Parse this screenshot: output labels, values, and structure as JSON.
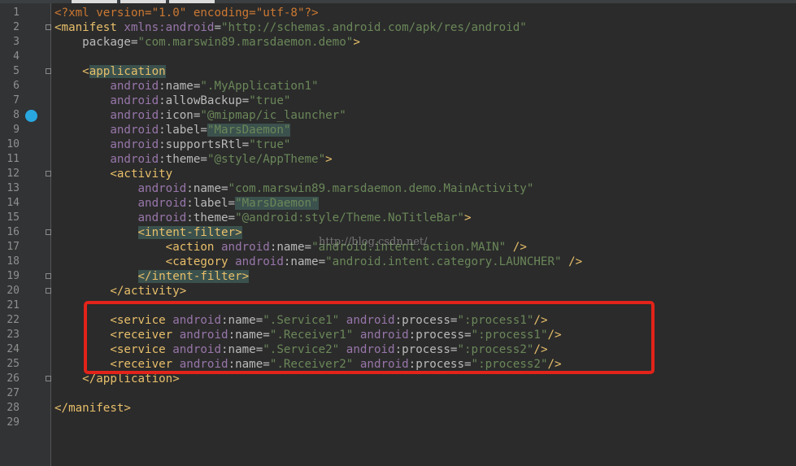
{
  "editor": {
    "watermark": "http://blog.csdn.net/",
    "highlight_color": "#e2231a",
    "breakpoint_color": "#29a8e0",
    "lines": [
      {
        "n": "1",
        "guide": "",
        "segs": [
          {
            "c": "ctl",
            "t": "<?xml version=\"1.0\" encoding=\"utf-8\"?>"
          }
        ]
      },
      {
        "n": "2",
        "guide": "",
        "segs": [
          {
            "c": "tag",
            "t": "<manifest "
          },
          {
            "c": "ns",
            "t": "xmlns:android"
          },
          {
            "c": "attr",
            "t": "="
          },
          {
            "c": "str",
            "t": "\"http://schemas.android.com/apk/res/android\""
          }
        ]
      },
      {
        "n": "3",
        "guide": "    ",
        "segs": [
          {
            "c": "attr",
            "t": "package"
          },
          {
            "c": "attr",
            "t": "="
          },
          {
            "c": "str",
            "t": "\"com.marswin89.marsdaemon.demo\""
          },
          {
            "c": "tag",
            "t": ">"
          }
        ]
      },
      {
        "n": "4",
        "guide": "",
        "segs": []
      },
      {
        "n": "5",
        "guide": "    ",
        "segs": [
          {
            "c": "tag",
            "t": "<"
          },
          {
            "c": "tag hl",
            "t": "application"
          }
        ]
      },
      {
        "n": "6",
        "guide": "        ",
        "segs": [
          {
            "c": "ns",
            "t": "android"
          },
          {
            "c": "attr",
            "t": ":name="
          },
          {
            "c": "str",
            "t": "\".MyApplication1\""
          }
        ]
      },
      {
        "n": "7",
        "guide": "        ",
        "segs": [
          {
            "c": "ns",
            "t": "android"
          },
          {
            "c": "attr",
            "t": ":allowBackup="
          },
          {
            "c": "str",
            "t": "\"true\""
          }
        ]
      },
      {
        "n": "8",
        "guide": "        ",
        "segs": [
          {
            "c": "ns",
            "t": "android"
          },
          {
            "c": "attr",
            "t": ":icon="
          },
          {
            "c": "str",
            "t": "\"@mipmap/ic_launcher\""
          }
        ]
      },
      {
        "n": "9",
        "guide": "        ",
        "segs": [
          {
            "c": "ns",
            "t": "android"
          },
          {
            "c": "attr",
            "t": ":label="
          },
          {
            "c": "str hl",
            "t": "\"MarsDaemon\""
          }
        ]
      },
      {
        "n": "10",
        "guide": "        ",
        "segs": [
          {
            "c": "ns",
            "t": "android"
          },
          {
            "c": "attr",
            "t": ":supportsRtl="
          },
          {
            "c": "str",
            "t": "\"true\""
          }
        ]
      },
      {
        "n": "11",
        "guide": "        ",
        "segs": [
          {
            "c": "ns",
            "t": "android"
          },
          {
            "c": "attr",
            "t": ":theme="
          },
          {
            "c": "str",
            "t": "\"@style/AppTheme\""
          },
          {
            "c": "tag",
            "t": ">"
          }
        ]
      },
      {
        "n": "12",
        "guide": "        ",
        "segs": [
          {
            "c": "tag",
            "t": "<activity"
          }
        ]
      },
      {
        "n": "13",
        "guide": "            ",
        "segs": [
          {
            "c": "ns",
            "t": "android"
          },
          {
            "c": "attr",
            "t": ":name="
          },
          {
            "c": "str",
            "t": "\"com.marswin89.marsdaemon.demo.MainActivity\""
          }
        ]
      },
      {
        "n": "14",
        "guide": "            ",
        "segs": [
          {
            "c": "ns",
            "t": "android"
          },
          {
            "c": "attr",
            "t": ":label="
          },
          {
            "c": "str hl",
            "t": "\"MarsDaemon\""
          }
        ]
      },
      {
        "n": "15",
        "guide": "            ",
        "segs": [
          {
            "c": "ns",
            "t": "android"
          },
          {
            "c": "attr",
            "t": ":theme="
          },
          {
            "c": "str",
            "t": "\"@android:style/Theme.NoTitleBar\""
          },
          {
            "c": "tag",
            "t": ">"
          }
        ]
      },
      {
        "n": "16",
        "guide": "            ",
        "segs": [
          {
            "c": "tag hl",
            "t": "<intent-filter>"
          }
        ]
      },
      {
        "n": "17",
        "guide": "                ",
        "segs": [
          {
            "c": "tag",
            "t": "<action "
          },
          {
            "c": "ns",
            "t": "android"
          },
          {
            "c": "attr",
            "t": ":name="
          },
          {
            "c": "str",
            "t": "\"android.intent.action.MAIN\""
          },
          {
            "c": "tag",
            "t": " />"
          }
        ]
      },
      {
        "n": "18",
        "guide": "                ",
        "segs": [
          {
            "c": "tag",
            "t": "<category "
          },
          {
            "c": "ns",
            "t": "android"
          },
          {
            "c": "attr",
            "t": ":name="
          },
          {
            "c": "str",
            "t": "\"android.intent.category.LAUNCHER\""
          },
          {
            "c": "tag",
            "t": " />"
          }
        ]
      },
      {
        "n": "19",
        "guide": "            ",
        "segs": [
          {
            "c": "tag hl",
            "t": "</intent-filter>"
          }
        ]
      },
      {
        "n": "20",
        "guide": "        ",
        "segs": [
          {
            "c": "tag",
            "t": "</activity>"
          }
        ]
      },
      {
        "n": "21",
        "guide": "",
        "segs": []
      },
      {
        "n": "22",
        "guide": "        ",
        "segs": [
          {
            "c": "tag",
            "t": "<service "
          },
          {
            "c": "ns",
            "t": "android"
          },
          {
            "c": "attr",
            "t": ":name="
          },
          {
            "c": "str",
            "t": "\".Service1\""
          },
          {
            "c": "attr",
            "t": " "
          },
          {
            "c": "ns",
            "t": "android"
          },
          {
            "c": "attr",
            "t": ":process="
          },
          {
            "c": "str",
            "t": "\":process1\""
          },
          {
            "c": "tag",
            "t": "/>"
          }
        ]
      },
      {
        "n": "23",
        "guide": "        ",
        "segs": [
          {
            "c": "tag",
            "t": "<receiver "
          },
          {
            "c": "ns",
            "t": "android"
          },
          {
            "c": "attr",
            "t": ":name="
          },
          {
            "c": "str",
            "t": "\".Receiver1\""
          },
          {
            "c": "attr",
            "t": " "
          },
          {
            "c": "ns",
            "t": "android"
          },
          {
            "c": "attr",
            "t": ":process="
          },
          {
            "c": "str",
            "t": "\":process1\""
          },
          {
            "c": "tag",
            "t": "/>"
          }
        ]
      },
      {
        "n": "24",
        "guide": "        ",
        "segs": [
          {
            "c": "tag",
            "t": "<service "
          },
          {
            "c": "ns",
            "t": "android"
          },
          {
            "c": "attr",
            "t": ":name="
          },
          {
            "c": "str",
            "t": "\".Service2\""
          },
          {
            "c": "attr",
            "t": " "
          },
          {
            "c": "ns",
            "t": "android"
          },
          {
            "c": "attr",
            "t": ":process="
          },
          {
            "c": "str",
            "t": "\":process2\""
          },
          {
            "c": "tag",
            "t": "/>"
          }
        ]
      },
      {
        "n": "25",
        "guide": "        ",
        "segs": [
          {
            "c": "tag",
            "t": "<receiver "
          },
          {
            "c": "ns",
            "t": "android"
          },
          {
            "c": "attr",
            "t": ":name="
          },
          {
            "c": "str",
            "t": "\".Receiver2\""
          },
          {
            "c": "attr",
            "t": " "
          },
          {
            "c": "ns",
            "t": "android"
          },
          {
            "c": "attr",
            "t": ":process="
          },
          {
            "c": "str",
            "t": "\":process2\""
          },
          {
            "c": "tag",
            "t": "/>"
          }
        ]
      },
      {
        "n": "26",
        "guide": "    ",
        "segs": [
          {
            "c": "tag",
            "t": "</application>"
          }
        ]
      },
      {
        "n": "27",
        "guide": "",
        "segs": []
      },
      {
        "n": "28",
        "guide": "",
        "segs": [
          {
            "c": "tag",
            "t": "</manifest>"
          }
        ]
      },
      {
        "n": "29",
        "guide": "",
        "segs": []
      }
    ]
  }
}
